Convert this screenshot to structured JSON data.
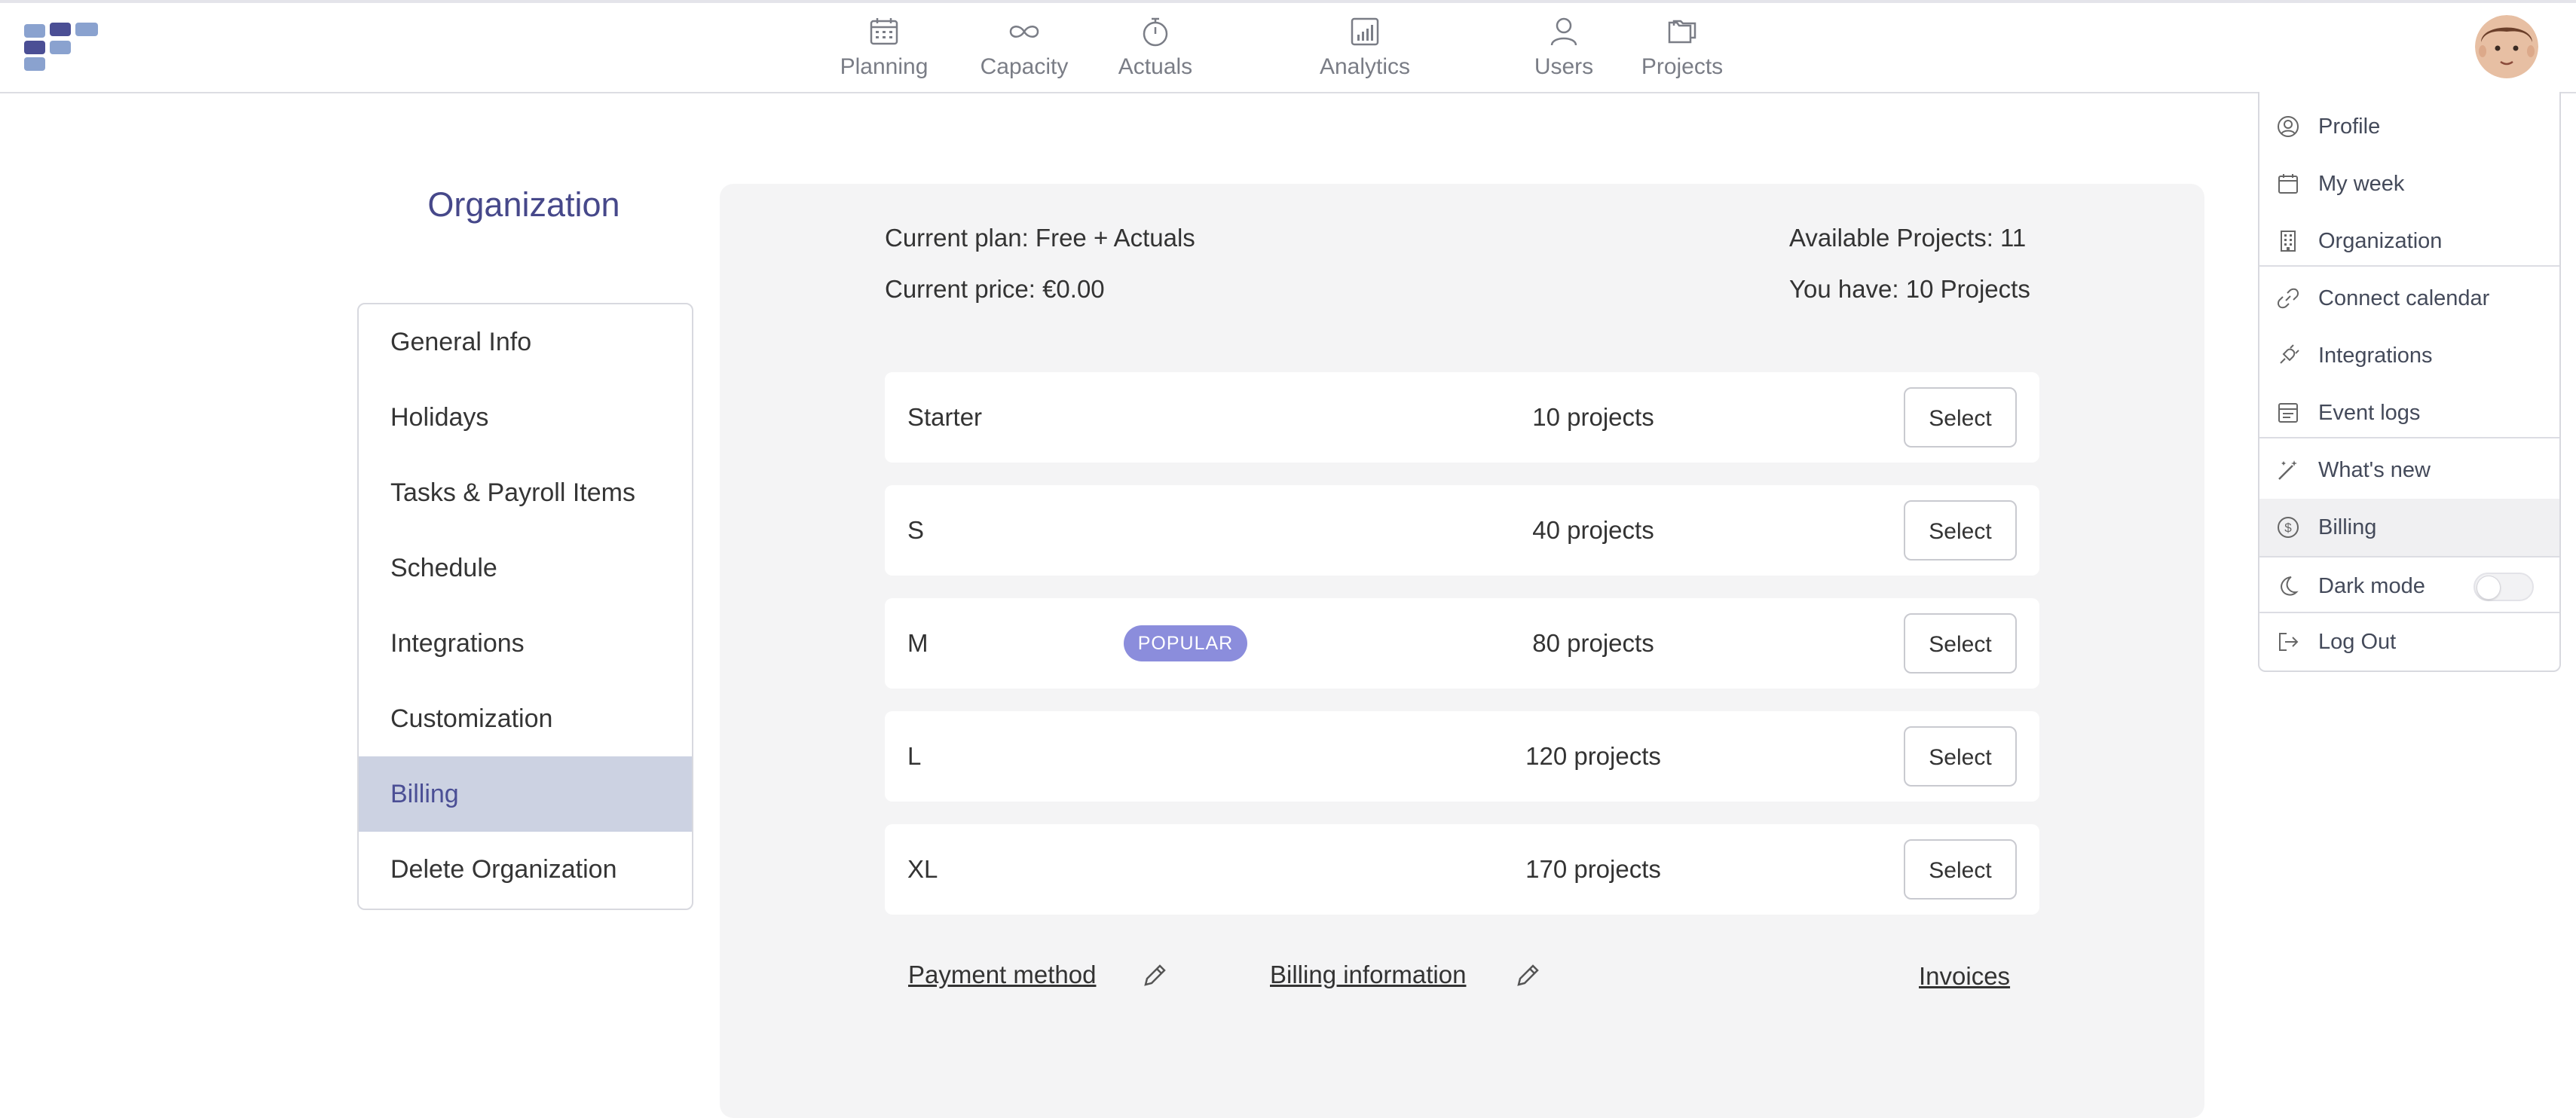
{
  "nav": [
    {
      "label": "Planning",
      "icon": "calendar-icon"
    },
    {
      "label": "Capacity",
      "icon": "infinity-icon"
    },
    {
      "label": "Actuals",
      "icon": "stopwatch-icon"
    },
    {
      "label": "Analytics",
      "icon": "bar-chart-icon"
    },
    {
      "label": "Users",
      "icon": "user-icon"
    },
    {
      "label": "Projects",
      "icon": "folders-icon"
    }
  ],
  "org": {
    "title": "Organization",
    "menu": [
      {
        "label": "General Info"
      },
      {
        "label": "Holidays"
      },
      {
        "label": "Tasks & Payroll Items"
      },
      {
        "label": "Schedule"
      },
      {
        "label": "Integrations"
      },
      {
        "label": "Customization"
      },
      {
        "label": "Billing",
        "active": true
      },
      {
        "label": "Delete Organization"
      }
    ]
  },
  "billing": {
    "current_plan": "Current plan: Free + Actuals",
    "current_price": "Current price: €0.00",
    "available_projects": "Available Projects: 11",
    "you_have": "You have: 10 Projects",
    "tiers": [
      {
        "name": "Starter",
        "projects": "10 projects",
        "badge": "",
        "select": "Select"
      },
      {
        "name": "S",
        "projects": "40 projects",
        "badge": "",
        "select": "Select"
      },
      {
        "name": "M",
        "projects": "80 projects",
        "badge": "POPULAR",
        "select": "Select"
      },
      {
        "name": "L",
        "projects": "120 projects",
        "badge": "",
        "select": "Select"
      },
      {
        "name": "XL",
        "projects": "170 projects",
        "badge": "",
        "select": "Select"
      }
    ],
    "payment_method": "Payment method",
    "billing_information": "Billing information",
    "invoices": "Invoices"
  },
  "dropdown": {
    "items": [
      {
        "label": "Profile",
        "icon": "user-circle-icon"
      },
      {
        "label": "My week",
        "icon": "calendar-icon"
      },
      {
        "label": "Organization",
        "icon": "building-icon"
      },
      {
        "label": "Connect calendar",
        "icon": "link-icon"
      },
      {
        "label": "Integrations",
        "icon": "plug-icon"
      },
      {
        "label": "Event logs",
        "icon": "log-icon"
      },
      {
        "label": "What's new",
        "icon": "magic-wand-icon"
      },
      {
        "label": "Billing",
        "icon": "dollar-circle-icon",
        "active": true
      },
      {
        "label": "Dark mode",
        "icon": "moon-icon",
        "toggle": "off"
      },
      {
        "label": "Log Out",
        "icon": "logout-icon"
      }
    ]
  },
  "colors": {
    "brand": "#4b4f95",
    "active_bg": "#ccd2e2",
    "badge": "#8b8ddc",
    "panel_bg": "#f4f4f5"
  }
}
